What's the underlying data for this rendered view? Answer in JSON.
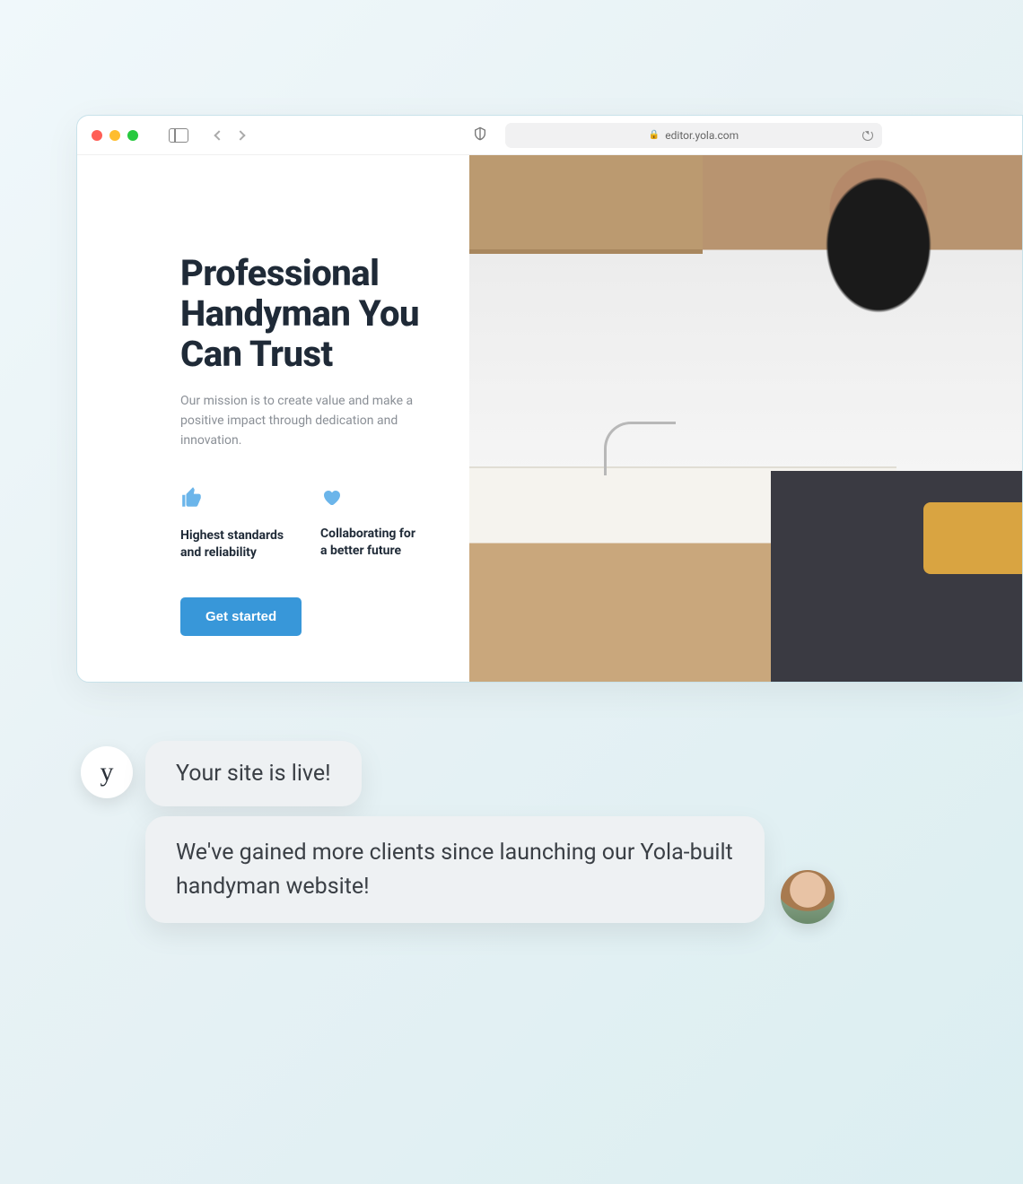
{
  "browser": {
    "url": "editor.yola.com"
  },
  "hero": {
    "title": "Professional Handyman You Can Trust",
    "subtitle": "Our mission is to create value and make a positive impact through dedication and innovation.",
    "features": [
      {
        "label": "Highest standards and reliability"
      },
      {
        "label": "Collaborating for a better future"
      }
    ],
    "cta": "Get started"
  },
  "chat": {
    "system_avatar": "y",
    "system_message": "Your site is live!",
    "testimonial": "We've gained more clients since launching our Yola-built handyman website!"
  }
}
